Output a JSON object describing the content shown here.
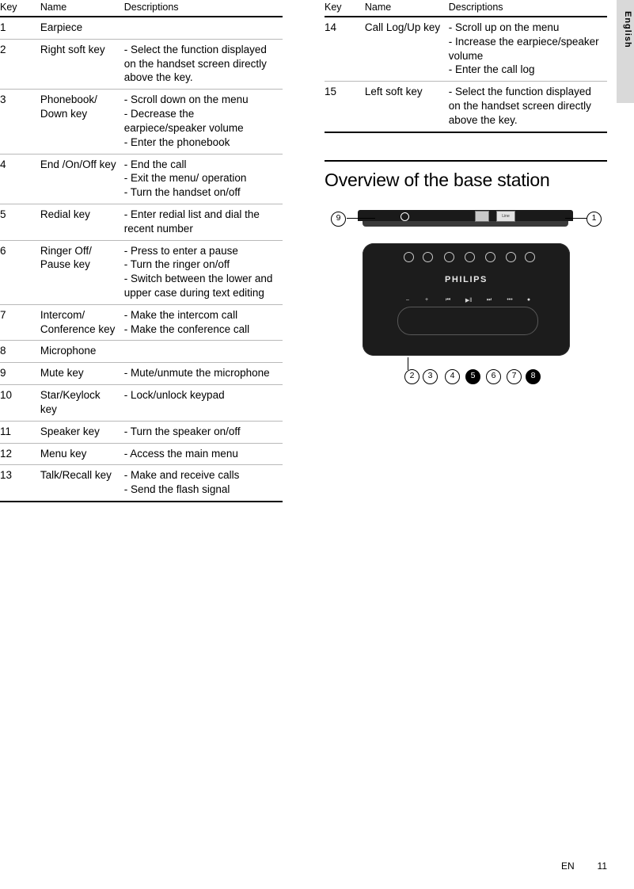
{
  "side_tab": {
    "label": "English"
  },
  "left_table": {
    "headers": {
      "key": "Key",
      "name": "Name",
      "descriptions": "Descriptions"
    },
    "rows": [
      {
        "key": "1",
        "name": "Earpiece",
        "desc": ""
      },
      {
        "key": "2",
        "name": "Right soft key",
        "desc": "- Select the function displayed on the handset screen directly above the key."
      },
      {
        "key": "3",
        "name": "Phonebook/ Down key",
        "desc": "- Scroll down on the menu\n- Decrease the earpiece/speaker volume\n- Enter the phonebook"
      },
      {
        "key": "4",
        "name": "End /On/Off key",
        "desc": "- End the call\n- Exit the menu/ operation\n- Turn the handset on/off"
      },
      {
        "key": "5",
        "name": "Redial key",
        "desc": "- Enter redial list and dial the recent number"
      },
      {
        "key": "6",
        "name": "Ringer Off/ Pause key",
        "desc": "- Press to enter a pause\n- Turn the ringer on/off\n- Switch between the lower and upper case during text editing"
      },
      {
        "key": "7",
        "name": "Intercom/ Conference key",
        "desc": "- Make the intercom call\n- Make the conference call"
      },
      {
        "key": "8",
        "name": "Microphone",
        "desc": ""
      },
      {
        "key": "9",
        "name": "Mute key",
        "desc": "- Mute/unmute the microphone"
      },
      {
        "key": "10",
        "name": "Star/Keylock key",
        "desc": "- Lock/unlock keypad"
      },
      {
        "key": "11",
        "name": "Speaker key",
        "desc": "- Turn the speaker on/off"
      },
      {
        "key": "12",
        "name": "Menu key",
        "desc": "- Access the main menu"
      },
      {
        "key": "13",
        "name": "Talk/Recall key",
        "desc": "- Make and receive calls\n- Send the flash signal"
      }
    ]
  },
  "right_table": {
    "headers": {
      "key": "Key",
      "name": "Name",
      "descriptions": "Descriptions"
    },
    "rows": [
      {
        "key": "14",
        "name": "Call Log/Up key",
        "desc": "- Scroll up on the menu\n- Increase the earpiece/speaker volume\n- Enter the call log"
      },
      {
        "key": "15",
        "name": "Left soft key",
        "desc": "- Select the function displayed on the handset screen directly above the key."
      }
    ]
  },
  "section": {
    "heading": "Overview of the base station"
  },
  "figure": {
    "brand": "PHILIPS",
    "rear_port_label": "Line",
    "callouts": {
      "left_rear": "9",
      "right_rear": "1",
      "front": [
        "2",
        "3",
        "4",
        "5",
        "6",
        "7",
        "8"
      ]
    },
    "button_glyphs": [
      "–",
      "+",
      "⏮",
      "▶‖",
      "⏭",
      "•••",
      "●"
    ]
  },
  "footer": {
    "locale": "EN",
    "page": "11"
  }
}
